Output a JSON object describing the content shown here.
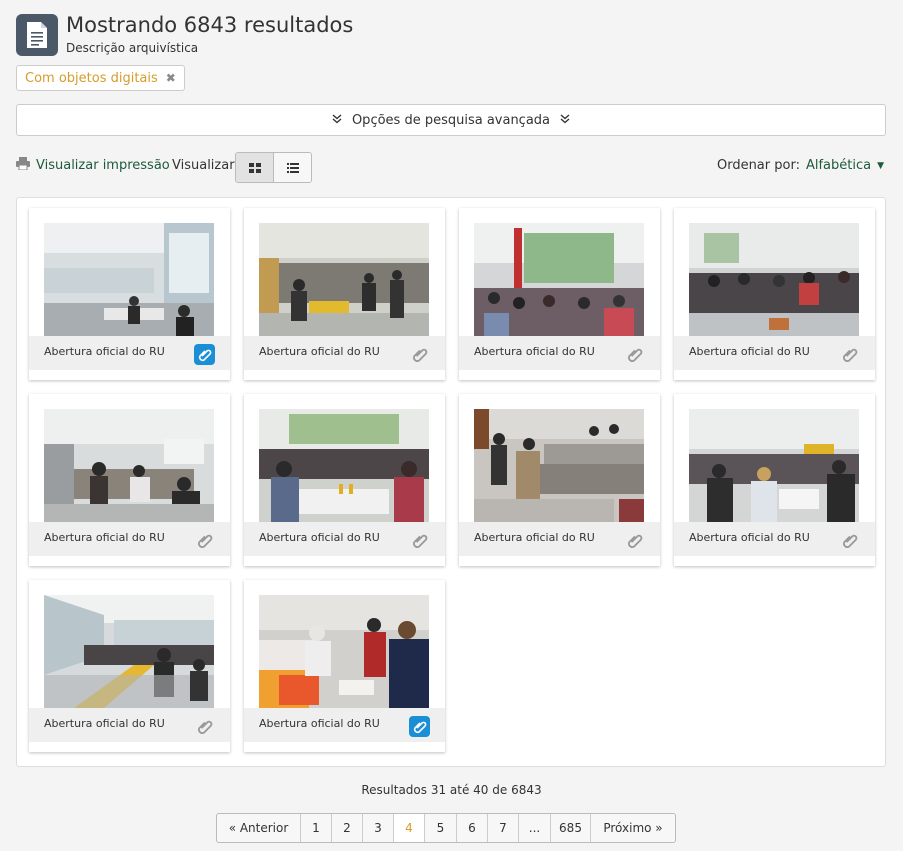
{
  "header": {
    "title": "Mostrando 6843 resultados",
    "subtitle": "Descrição arquivística",
    "icon": "document-icon"
  },
  "filter": {
    "label": "Com objetos digitais",
    "remove_icon": "close-icon"
  },
  "advanced_search": {
    "label": "Opções de pesquisa avançada",
    "icon": "double-chevron-down-icon"
  },
  "toolbar": {
    "print_label": "Visualizar impressão",
    "view_label": "Visualizar:",
    "sort_label": "Ordenar por:",
    "sort_value": "Alfabética"
  },
  "results": [
    {
      "title": "Abertura oficial do RU",
      "has_digital_object": true
    },
    {
      "title": "Abertura oficial do RU",
      "has_digital_object": false
    },
    {
      "title": "Abertura oficial do RU",
      "has_digital_object": false
    },
    {
      "title": "Abertura oficial do RU",
      "has_digital_object": false
    },
    {
      "title": "Abertura oficial do RU",
      "has_digital_object": false
    },
    {
      "title": "Abertura oficial do RU",
      "has_digital_object": false
    },
    {
      "title": "Abertura oficial do RU",
      "has_digital_object": false
    },
    {
      "title": "Abertura oficial do RU",
      "has_digital_object": false
    },
    {
      "title": "Abertura oficial do RU",
      "has_digital_object": false
    },
    {
      "title": "Abertura oficial do RU",
      "has_digital_object": true
    }
  ],
  "results_info": "Resultados 31 até 40 de 6843",
  "pagination": {
    "prev": "« Anterior",
    "pages": [
      "1",
      "2",
      "3",
      "4",
      "5",
      "6",
      "7",
      "...",
      "685"
    ],
    "current": "4",
    "next": "Próximo »"
  },
  "colors": {
    "accent_green": "#1f5a3b",
    "accent_gold": "#d79c2b",
    "active_clip": "#1a8fd6"
  }
}
